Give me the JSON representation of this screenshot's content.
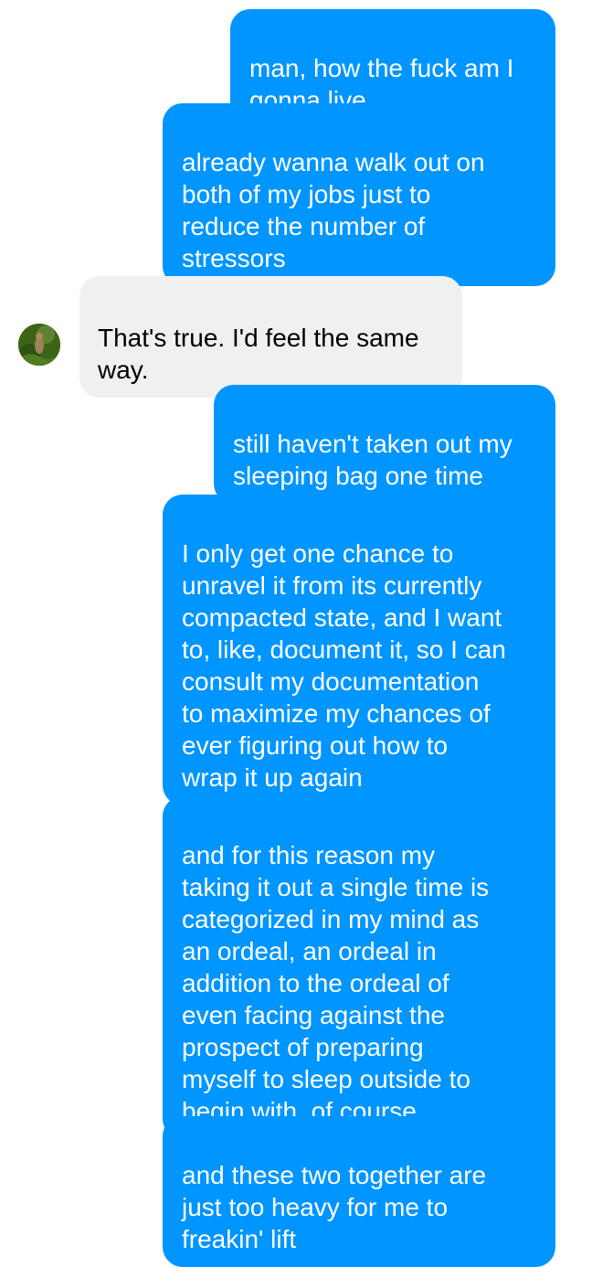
{
  "conversation": {
    "messages": [
      {
        "sender": "me",
        "text": "man, how the fuck am I\ngonna live"
      },
      {
        "sender": "me",
        "text": "already wanna walk out on\nboth of my jobs just to\nreduce the number of\nstressors"
      },
      {
        "sender": "them",
        "text": "That's true. I'd feel the same\nway."
      },
      {
        "sender": "me",
        "text": "still haven't taken out my\nsleeping bag one time"
      },
      {
        "sender": "me",
        "text": "I only get one chance to\nunravel it from its currently\ncompacted state, and I want\nto, like, document it, so I can\nconsult my documentation\nto maximize my chances of\never figuring out how to\nwrap it up again"
      },
      {
        "sender": "me",
        "text": "and for this reason my\ntaking it out a single time is\ncategorized in my mind as\nan ordeal, an ordeal in\naddition to the ordeal of\neven facing against the\nprospect of preparing\nmyself to sleep outside to\nbegin with, of course"
      },
      {
        "sender": "me",
        "text": "and these two together are\njust too heavy for me to\nfreakin' lift"
      }
    ],
    "contact_avatar": "contact-avatar-photo",
    "colors": {
      "outgoing_bubble": "#0095ff",
      "incoming_bubble": "#f0f0f0",
      "outgoing_text": "#ffffff",
      "incoming_text": "#000000"
    }
  }
}
